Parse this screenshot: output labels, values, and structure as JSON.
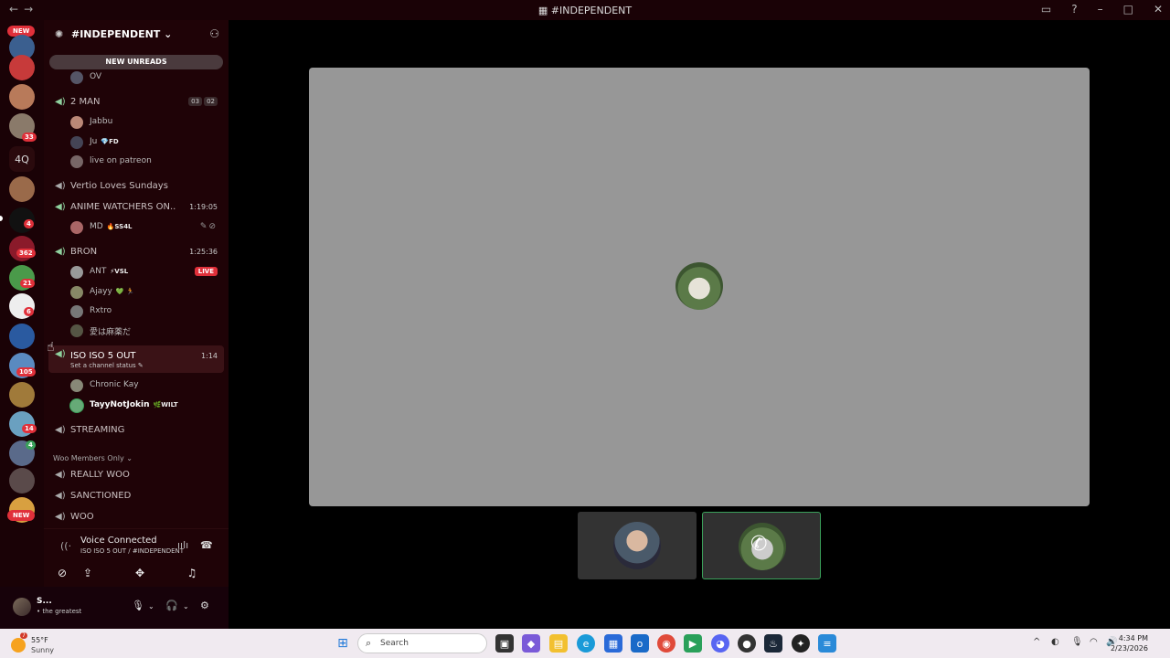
{
  "window": {
    "title": "#INDEPENDENT",
    "back": "←",
    "forward": "→"
  },
  "guild_rail": {
    "new_top": "NEW",
    "new_bottom": "NEW",
    "text_server": "4Q",
    "badges": [
      "33",
      "4",
      "362",
      "21",
      "6",
      "105",
      "14",
      "4"
    ]
  },
  "server": {
    "name": "#INDEPENDENT",
    "chevron": "⌄",
    "new_unreads": "NEW UNREADS"
  },
  "channels": [
    {
      "type": "user",
      "name": "OV",
      "color": "#556"
    },
    {
      "type": "voice",
      "name": "2 MAN",
      "pills": [
        "03",
        "02"
      ]
    },
    {
      "type": "user",
      "name": "Jabbu",
      "color": "#b87"
    },
    {
      "type": "user",
      "name": "Ju",
      "tag": "💎FD",
      "color": "#445"
    },
    {
      "type": "user",
      "name": "live on patreon",
      "color": "#766"
    },
    {
      "type": "voice",
      "name": "Vertio Loves Sundays"
    },
    {
      "type": "voice",
      "name": "ANIME WATCHERS ON...",
      "time": "1:19:05"
    },
    {
      "type": "user",
      "name": "MD",
      "tag": "🔥SS4L",
      "color": "#a66",
      "icons": "✎⊘"
    },
    {
      "type": "voice",
      "name": "BRON",
      "time": "1:25:36"
    },
    {
      "type": "user",
      "name": "ANT",
      "tag": "⚡VSL",
      "color": "#999",
      "live": "LIVE"
    },
    {
      "type": "user",
      "name": "Ajayy",
      "tag": "💚 🏃",
      "color": "#886"
    },
    {
      "type": "user",
      "name": "Rxtro",
      "color": "#777"
    },
    {
      "type": "user",
      "name": "愛は麻薬だ",
      "color": "#554"
    },
    {
      "type": "voice_active",
      "name": "ISO ISO 5 OUT",
      "time": "1:14",
      "status": "Set a channel status ✎"
    },
    {
      "type": "user",
      "name": "Chronic Kay",
      "color": "#887"
    },
    {
      "type": "user",
      "name": "TayyNotJokin",
      "tag": "🌿WILT",
      "color": "#6a7",
      "bold": true
    },
    {
      "type": "voice",
      "name": "STREAMING"
    },
    {
      "type": "category",
      "name": "Woo Members Only ⌄"
    },
    {
      "type": "voice",
      "name": "REALLY WOO"
    },
    {
      "type": "voice",
      "name": "SANCTIONED"
    },
    {
      "type": "voice",
      "name": "WOO"
    }
  ],
  "voice": {
    "status": "Voice Connected",
    "channel": "ISO ISO 5 OUT / #INDEPENDENT"
  },
  "user": {
    "name": "S...",
    "status": "• the greatest"
  },
  "taskbar": {
    "temp": "55°F",
    "condition": "Sunny",
    "weather_badge": "7",
    "search_placeholder": "Search",
    "time": "4:34 PM",
    "date": "2/23/2026"
  },
  "colors": {
    "accent_red": "#e0303a",
    "voice_green": "#8fd19e",
    "speaking_border": "#3aa05a"
  }
}
